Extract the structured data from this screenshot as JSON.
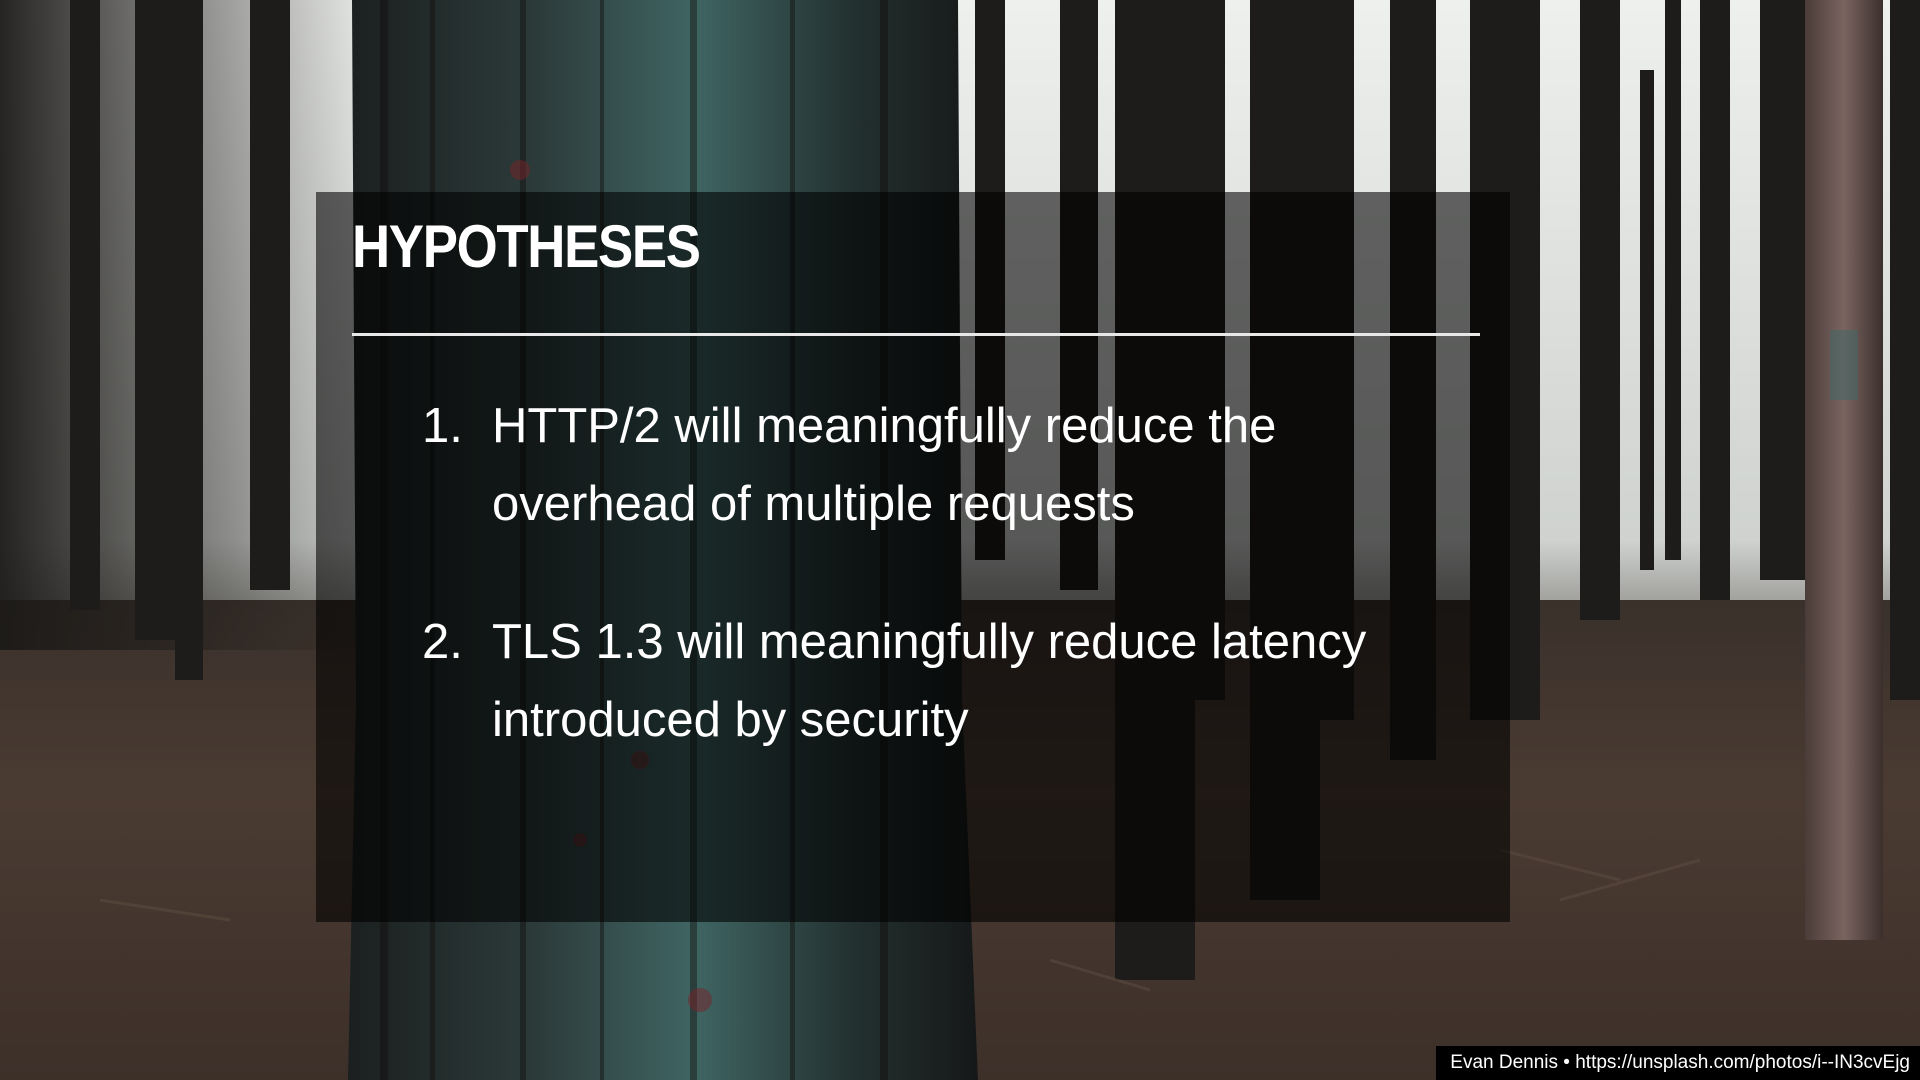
{
  "slide": {
    "title": "HYPOTHESES",
    "items": [
      {
        "number": "1.",
        "text": "HTTP/2 will meaningfully reduce the overhead of multiple requests"
      },
      {
        "number": "2.",
        "text": "TLS 1.3 will meaningfully reduce latency introduced by security"
      }
    ],
    "credit": "Evan Dennis • https://unsplash.com/photos/i--IN3cvEjg"
  },
  "colors": {
    "text": "#ffffff",
    "rule": "#e8e8e8",
    "panel_overlay": "rgba(0,0,0,0.58)",
    "credit_background": "#000000"
  }
}
